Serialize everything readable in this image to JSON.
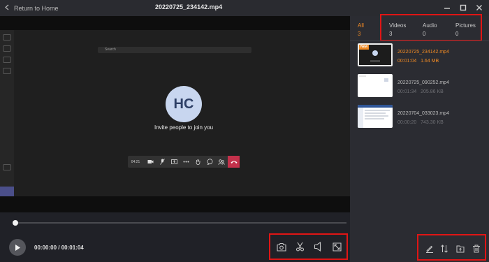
{
  "titlebar": {
    "back_label": "Return to Home",
    "filename": "20220725_234142.mp4",
    "buttons": [
      "minimize-icon",
      "maximize-icon",
      "close-icon"
    ]
  },
  "video": {
    "search_placeholder": "Search",
    "avatar_initials": "HC",
    "invite_text": "Invite people to join you",
    "call_timer": "04:21"
  },
  "playback": {
    "current_time": "00:00:00",
    "separator": " / ",
    "duration": "00:01:04",
    "progress": 0,
    "tools": [
      "snapshot-icon",
      "cut-icon",
      "volume-icon",
      "fullscreen-icon"
    ]
  },
  "tabs": [
    {
      "label": "All",
      "count": "3",
      "active": true
    },
    {
      "label": "Videos",
      "count": "3",
      "active": false
    },
    {
      "label": "Audio",
      "count": "0",
      "active": false
    },
    {
      "label": "Pictures",
      "count": "0",
      "active": false
    }
  ],
  "files": [
    {
      "name": "20220725_234142.mp4",
      "duration": "00:01:04",
      "size": "1.64 MB",
      "badge": "New",
      "selected": true
    },
    {
      "name": "20220725_090252.mp4",
      "duration": "00:01:34",
      "size": "205.86 KB",
      "badge": "",
      "selected": false
    },
    {
      "name": "20220704_033023.mp4",
      "duration": "00:00:20",
      "size": "743.30 KB",
      "badge": "",
      "selected": false
    }
  ],
  "panel_tools": [
    "rename-icon",
    "sort-icon",
    "open-folder-icon",
    "delete-icon"
  ],
  "colors": {
    "accent": "#f08a24",
    "highlight": "#e01515",
    "end_call": "#c4314b"
  }
}
